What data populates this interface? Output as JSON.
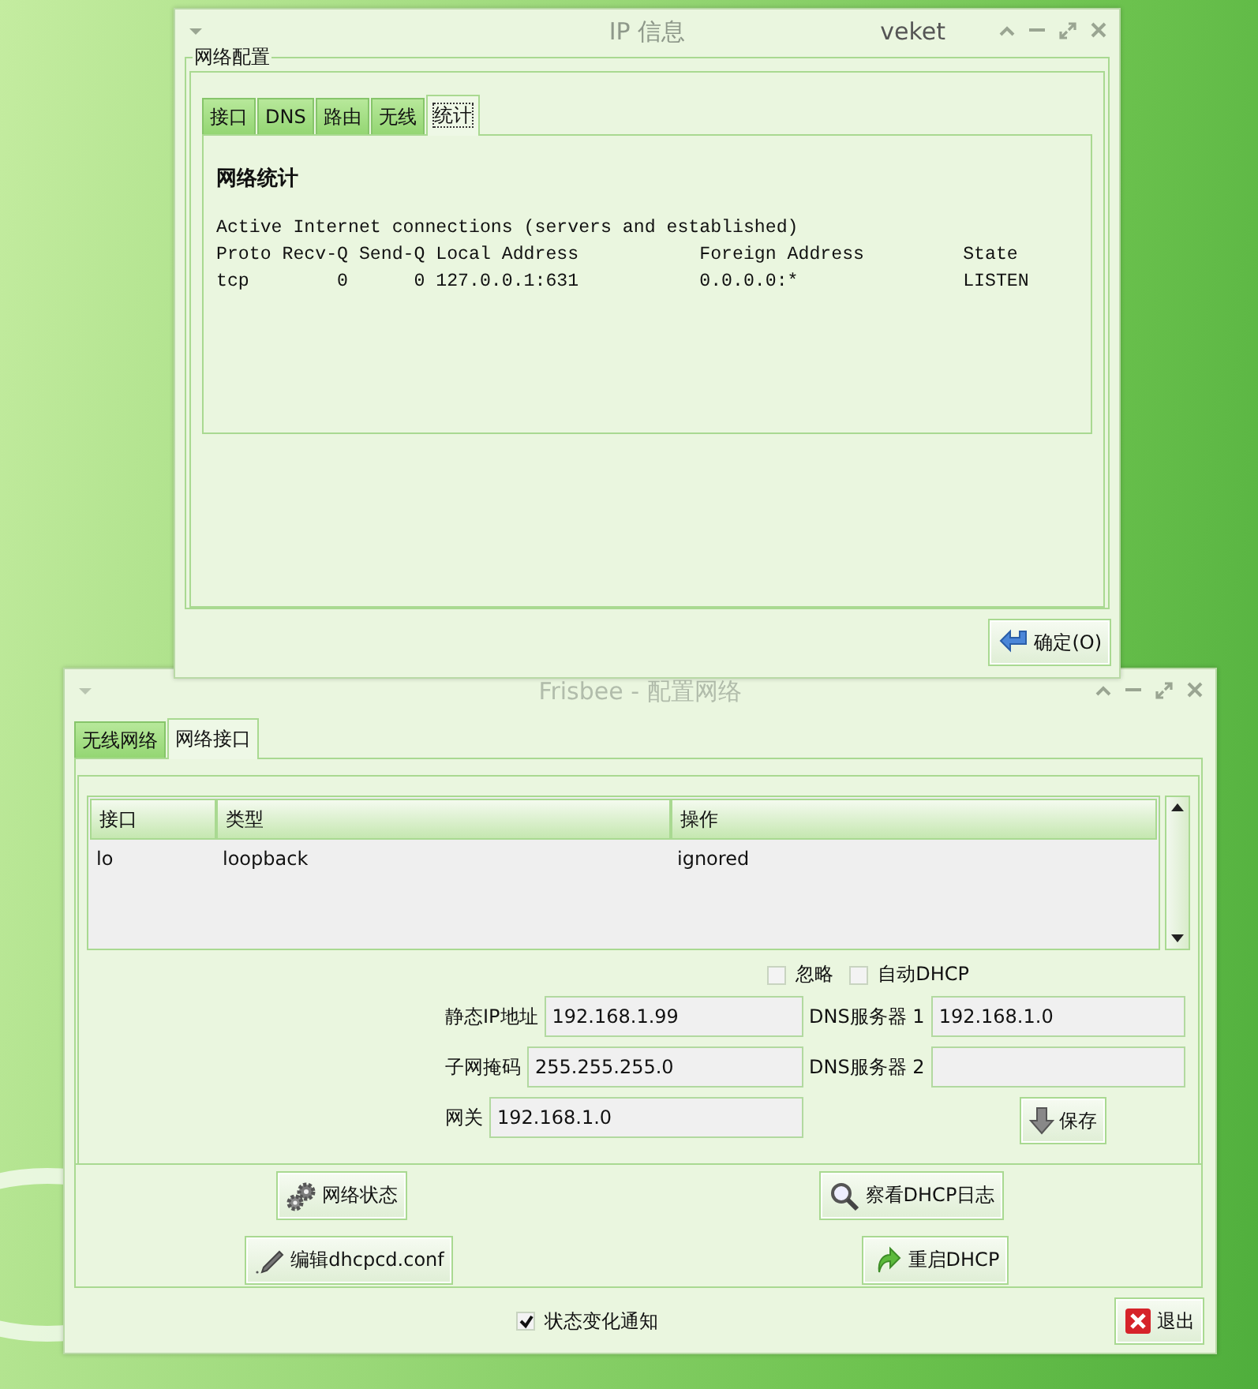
{
  "ip_window": {
    "title": "IP 信息",
    "user": "veket",
    "group_label": "网络配置",
    "tabs": [
      {
        "label": "接口",
        "selected": false
      },
      {
        "label": "DNS",
        "selected": false
      },
      {
        "label": "路由",
        "selected": false
      },
      {
        "label": "无线",
        "selected": false
      },
      {
        "label": "统计",
        "selected": true
      }
    ],
    "heading": "网络统计",
    "lines": [
      "Active Internet connections (servers and established)",
      "Proto Recv-Q Send-Q Local Address           Foreign Address         State",
      "tcp        0      0 127.0.0.1:631           0.0.0.0:*               LISTEN"
    ],
    "ok_button": "确定(O)"
  },
  "frisbee_window": {
    "title": "Frisbee - 配置网络",
    "tabs": [
      {
        "label": "无线网络",
        "selected": false
      },
      {
        "label": "网络接口",
        "selected": true
      }
    ],
    "table": {
      "columns": [
        "接口",
        "类型",
        "操作"
      ],
      "rows": [
        [
          "lo",
          "loopback",
          "ignored"
        ]
      ]
    },
    "checkboxes": [
      {
        "label": "忽略",
        "checked": false
      },
      {
        "label": "自动DHCP",
        "checked": false
      }
    ],
    "left_fields": [
      {
        "label": "静态IP地址",
        "value": "192.168.1.99"
      },
      {
        "label": "子网掩码",
        "value": "255.255.255.0"
      },
      {
        "label": "网关",
        "value": "192.168.1.0"
      }
    ],
    "right_fields": [
      {
        "label": "DNS服务器 1",
        "value": "192.168.1.0"
      },
      {
        "label": "DNS服务器 2"
      }
    ],
    "save_button": "保存",
    "buttons": [
      {
        "kind": "status",
        "label": "网络状态"
      },
      {
        "kind": "log",
        "label": "察看DHCP日志"
      },
      {
        "kind": "edit",
        "label": "编辑dhcpcd.conf"
      },
      {
        "kind": "restart",
        "label": "重启DHCP"
      }
    ],
    "notify": {
      "label": "状态变化通知",
      "checked": true
    },
    "exit_button": "退出"
  }
}
